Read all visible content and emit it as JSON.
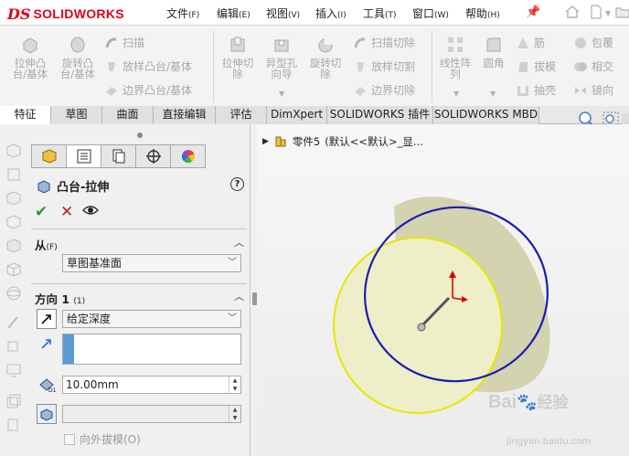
{
  "app": {
    "logo_ds": "DS",
    "logo_name": "SOLIDWORKS"
  },
  "menu": [
    {
      "label": "文件",
      "key": "(F)"
    },
    {
      "label": "编辑",
      "key": "(E)"
    },
    {
      "label": "视图",
      "key": "(V)"
    },
    {
      "label": "插入",
      "key": "(I)"
    },
    {
      "label": "工具",
      "key": "(T)"
    },
    {
      "label": "窗口",
      "key": "(W)"
    },
    {
      "label": "帮助",
      "key": "(H)"
    }
  ],
  "ribbon": {
    "extrude_boss": "拉伸凸台/基体",
    "revolve_boss": "旋转凸台/基体",
    "sweep": "扫描",
    "loft_boss": "放样凸台/基体",
    "boundary_boss": "边界凸台/基体",
    "extrude_cut": "拉伸切除",
    "hole_wizard": "异型孔向导",
    "revolve_cut": "旋转切除",
    "sweep_cut": "扫描切除",
    "loft_cut": "放样切割",
    "boundary_cut": "边界切除",
    "linear_pattern": "线性阵列",
    "fillet": "圆角",
    "rib": "筋",
    "draft": "拔模",
    "shell": "抽壳",
    "wrap": "包覆",
    "intersect": "相交",
    "mirror": "镜向"
  },
  "tabs": [
    "特征",
    "草图",
    "曲面",
    "直接编辑",
    "评估",
    "DimXpert",
    "SOLIDWORKS 插件",
    "SOLIDWORKS MBD"
  ],
  "panel": {
    "title": "凸台-拉伸",
    "help": "?",
    "from_section": "从",
    "from_key": "(F)",
    "from_value": "草图基准面",
    "dir_section": "方向 1",
    "dir_key": "(1)",
    "end_condition": "给定深度",
    "depth_value": "10.00mm",
    "draft_outward": "向外拔模",
    "draft_key": "(O)"
  },
  "tree": {
    "part_name": "零件5",
    "config": "(默认<<默认>_显..."
  },
  "watermark": {
    "brand": "Bai",
    "brand2": "经验",
    "url": "jingyan.baidu.com"
  },
  "colors": {
    "brand_red": "#e0001b",
    "ok_green": "#2a9a2a",
    "cancel_red": "#c32020",
    "preview_face": "#eeeec8",
    "edge_blue": "#1c1cb0",
    "edge_yellow": "#e6e600",
    "selection_blue": "#5b9bd5"
  }
}
